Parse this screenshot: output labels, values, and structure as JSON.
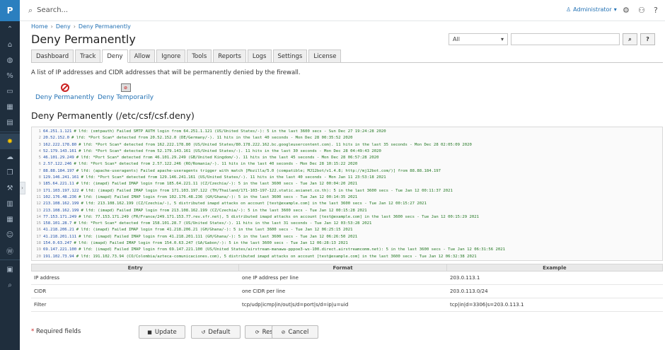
{
  "app": {
    "logo": "P"
  },
  "topbar": {
    "search_placeholder": "Search...",
    "admin_label": "Administrator"
  },
  "breadcrumb": [
    "Home",
    "Deny",
    "Deny Permanently"
  ],
  "page_title": "Deny Permanently",
  "filter": {
    "selected": "All"
  },
  "tabs": [
    "Dashboard",
    "Track",
    "Deny",
    "Allow",
    "Ignore",
    "Tools",
    "Reports",
    "Logs",
    "Settings",
    "License"
  ],
  "active_tab": "Deny",
  "description": "A list of IP addresses and CIDR addresses that will be permanently denied by the firewall.",
  "actions": [
    {
      "label": "Deny Permanently",
      "icon": "no-entry-icon"
    },
    {
      "label": "Deny Temporarily",
      "icon": "calendar-deny-icon"
    }
  ],
  "section_title": "Deny Permanently (/etc/csf/csf.deny)",
  "log_lines": [
    {
      "n": "1",
      "ip": "64.251.1.121",
      "msg": "# lfd: (smtpauth) Failed SMTP AUTH login from 64.251.1.121 (US/United States/-): 5 in the last 3600 secs - Sun Dec 27 19:24:28 2020"
    },
    {
      "n": "2",
      "ip": "20.52.152.0",
      "msg": "# lfd: *Port Scan* detected from 20.52.152.0 (DE/Germany/-). 11 hits in the last 40 seconds - Mon Dec 28 00:35:52 2020"
    },
    {
      "n": "3",
      "ip": "162.222.178.80",
      "msg": "# lfd: *Port Scan* detected from 162.222.178.80 (US/United States/80.178.222.162.bc.googleusercontent.com). 11 hits in the last 35 seconds - Mon Dec 28 02:05:09 2020"
    },
    {
      "n": "4",
      "ip": "52.179.143.161",
      "msg": "# lfd: *Port Scan* detected from 52.179.143.161 (US/United States/-). 11 hits in the last 30 seconds - Mon Dec 28 04:49:43 2020"
    },
    {
      "n": "5",
      "ip": "46.101.29.249",
      "msg": "# lfd: *Port Scan* detected from 46.101.29.249 (GB/United Kingdom/-). 11 hits in the last 45 seconds - Mon Dec 28 06:57:28 2020"
    },
    {
      "n": "6",
      "ip": "2.57.122.246",
      "msg": "# lfd: *Port Scan* detected from 2.57.122.246 (RO/Romania/-). 11 hits in the last 40 seconds - Mon Dec 28 10:15:22 2020"
    },
    {
      "n": "7",
      "ip": "88.88.184.197",
      "msg": "# lfd: (apache-useragents) Failed apache-useragents trigger with match [Mozilla/5.0 (compatible; MJ12bot/v1.4.8; http://mj12bot.com/)] from 88.88.184.197"
    },
    {
      "n": "8",
      "ip": "129.146.241.161",
      "msg": "# lfd: *Port Scan* detected from 129.146.241.161 (US/United States/-). 11 hits in the last 40 seconds - Mon Jan 11 23:53:18 2021"
    },
    {
      "n": "9",
      "ip": "185.64.221.11",
      "msg": "# lfd: (imapd) Failed IMAP login from 185.64.221.11 (CZ/Czechia/-): 5 in the last 3600 secs - Tue Jan 12 00:04:20 2021"
    },
    {
      "n": "10",
      "ip": "171.103.197.122",
      "msg": "# lfd: (imapd) Failed IMAP login from 171.103.197.122 (TH/Thailand/171-103-197-122.static.asianet.co.th): 5 in the last 3600 secs - Tue Jan 12 00:11:37 2021"
    },
    {
      "n": "11",
      "ip": "102.176.48.236",
      "msg": "# lfd: (imapd) Failed IMAP login from 102.176.48.236 (GH/Ghana/-): 5 in the last 3600 secs - Tue Jan 12 00:14:35 2021"
    },
    {
      "n": "12",
      "ip": "213.108.162.199",
      "msg": "# lfd: 213.108.162.199 (CZ/Czechia/-), 5 distributed imapd attacks on account [test@example.com] in the last 3600 secs - Tue Jan 12 00:15:27 2021"
    },
    {
      "n": "13",
      "ip": "213.108.162.199",
      "msg": "# lfd: (imapd) Failed IMAP login from 213.108.162.199 (CZ/Czechia/-): 5 in the last 3600 secs - Tue Jan 12 00:15:28 2021"
    },
    {
      "n": "14",
      "ip": "77.153.171.249",
      "msg": "# lfd: 77.153.171.249 (FR/France/249.171.153.77.rev.sfr.net), 5 distributed imapd attacks on account [test@example.com] in the last 3600 secs - Tue Jan 12 00:15:29 2021"
    },
    {
      "n": "15",
      "ip": "158.101.28.7",
      "msg": "# lfd: *Port Scan* detected from 158.101.28.7 (US/United States/-). 11 hits in the last 31 seconds - Tue Jan 12 03:53:28 2021"
    },
    {
      "n": "16",
      "ip": "41.218.206.21",
      "msg": "# lfd: (imapd) Failed IMAP login from 41.218.206.21 (GH/Ghana/-): 5 in the last 3600 secs - Tue Jan 12 06:25:15 2021"
    },
    {
      "n": "17",
      "ip": "41.218.201.111",
      "msg": "# lfd: (imapd) Failed IMAP login from 41.218.201.111 (GH/Ghana/-): 5 in the last 3600 secs - Tue Jan 12 06:26:50 2021"
    },
    {
      "n": "18",
      "ip": "154.0.63.247",
      "msg": "# lfd: (imapd) Failed IMAP login from 154.0.63.247 (GA/Gabon/-): 5 in the last 3600 secs - Tue Jan 12 06:28:13 2021"
    },
    {
      "n": "19",
      "ip": "69.147.221.100",
      "msg": "# lfd: (imapd) Failed IMAP login from 69.147.221.100 (US/United States/airstream-manawa-pppoe3-ws-100.direct.airstreamcomm.net): 5 in the last 3600 secs - Tue Jan 12 06:31:56 2021"
    },
    {
      "n": "20",
      "ip": "191.102.73.94",
      "msg": "# lfd: 191.102.73.94 (CO/Colombia/azteca-comunicaciones.com), 5 distributed imapd attacks on account [test@example.com] in the last 3600 secs - Tue Jan 12 06:32:38 2021"
    }
  ],
  "table": {
    "headers": [
      "Entry",
      "Format",
      "Example"
    ],
    "rows": [
      [
        "IP address",
        "one IP address per line",
        "203.0.113.1"
      ],
      [
        "CIDR",
        "one CIDR per line",
        "203.0.113.0/24"
      ],
      [
        "Filter",
        "tcp/udp|icmp|in/out|s/d=port|s/d=ip|u=uid",
        "tcp|in|d=3306|s=203.0.113.1"
      ]
    ]
  },
  "required_label": "Required fields",
  "buttons": {
    "update": "Update",
    "default": "Default",
    "restart": "Restart",
    "cancel": "Cancel"
  }
}
